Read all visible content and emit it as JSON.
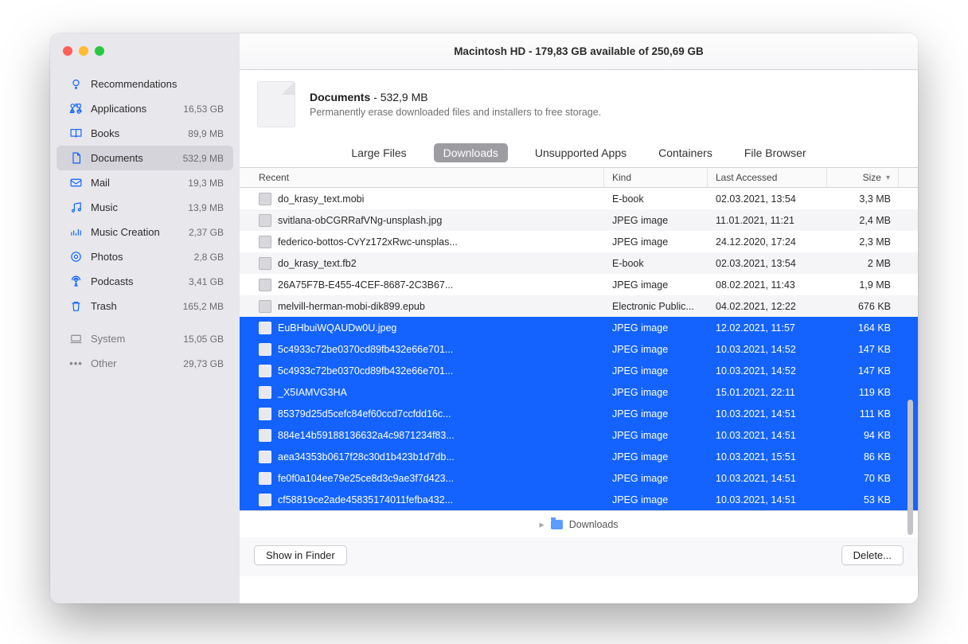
{
  "title": "Macintosh HD - 179,83 GB available of 250,69 GB",
  "info": {
    "name": "Documents",
    "size": "532,9 MB",
    "desc": "Permanently erase downloaded files and installers to free storage."
  },
  "sidebar": [
    {
      "icon": "bulb",
      "label": "Recommendations",
      "size": ""
    },
    {
      "icon": "apps",
      "label": "Applications",
      "size": "16,53 GB"
    },
    {
      "icon": "book",
      "label": "Books",
      "size": "89,9 MB"
    },
    {
      "icon": "doc",
      "label": "Documents",
      "size": "532,9 MB",
      "selected": true
    },
    {
      "icon": "mail",
      "label": "Mail",
      "size": "19,3 MB"
    },
    {
      "icon": "music",
      "label": "Music",
      "size": "13,9 MB"
    },
    {
      "icon": "garage",
      "label": "Music Creation",
      "size": "2,37 GB"
    },
    {
      "icon": "photos",
      "label": "Photos",
      "size": "2,8 GB"
    },
    {
      "icon": "podcast",
      "label": "Podcasts",
      "size": "3,41 GB"
    },
    {
      "icon": "trash",
      "label": "Trash",
      "size": "165,2 MB"
    }
  ],
  "sidebar2": [
    {
      "icon": "laptop",
      "label": "System",
      "size": "15,05 GB"
    },
    {
      "icon": "dots",
      "label": "Other",
      "size": "29,73 GB"
    }
  ],
  "tabs": {
    "large": "Large Files",
    "downloads": "Downloads",
    "unsupported": "Unsupported Apps",
    "containers": "Containers",
    "browser": "File Browser"
  },
  "columns": {
    "name": "Recent",
    "kind": "Kind",
    "last": "Last Accessed",
    "size": "Size"
  },
  "rows": [
    {
      "name": "do_krasy_text.mobi",
      "kind": "E-book",
      "last": "02.03.2021, 13:54",
      "size": "3,3 MB"
    },
    {
      "name": "svitlana-obCGRRafVNg-unsplash.jpg",
      "kind": "JPEG image",
      "last": "11.01.2021, 11:21",
      "size": "2,4 MB"
    },
    {
      "name": "federico-bottos-CvYz172xRwc-unsplas...",
      "kind": "JPEG image",
      "last": "24.12.2020, 17:24",
      "size": "2,3 MB"
    },
    {
      "name": "do_krasy_text.fb2",
      "kind": "E-book",
      "last": "02.03.2021, 13:54",
      "size": "2 MB"
    },
    {
      "name": "26A75F7B-E455-4CEF-8687-2C3B67...",
      "kind": "JPEG image",
      "last": "08.02.2021, 11:43",
      "size": "1,9 MB"
    },
    {
      "name": "melvill-herman-mobi-dik899.epub",
      "kind": "Electronic Public...",
      "last": "04.02.2021, 12:22",
      "size": "676 KB"
    },
    {
      "name": "EuBHbuiWQAUDw0U.jpeg",
      "kind": "JPEG image",
      "last": "12.02.2021, 11:57",
      "size": "164 KB",
      "sel": true
    },
    {
      "name": "5c4933c72be0370cd89fb432e66e701...",
      "kind": "JPEG image",
      "last": "10.03.2021, 14:52",
      "size": "147 KB",
      "sel": true
    },
    {
      "name": "5c4933c72be0370cd89fb432e66e701...",
      "kind": "JPEG image",
      "last": "10.03.2021, 14:52",
      "size": "147 KB",
      "sel": true
    },
    {
      "name": "_X5IAMVG3HA",
      "kind": "JPEG image",
      "last": "15.01.2021, 22:11",
      "size": "119 KB",
      "sel": true
    },
    {
      "name": "85379d25d5cefc84ef60ccd7ccfdd16c...",
      "kind": "JPEG image",
      "last": "10.03.2021, 14:51",
      "size": "111 KB",
      "sel": true
    },
    {
      "name": "884e14b59188136632a4c9871234f83...",
      "kind": "JPEG image",
      "last": "10.03.2021, 14:51",
      "size": "94 KB",
      "sel": true
    },
    {
      "name": "aea34353b0617f28c30d1b423b1d7db...",
      "kind": "JPEG image",
      "last": "10.03.2021, 15:51",
      "size": "86 KB",
      "sel": true
    },
    {
      "name": "fe0f0a104ee79e25ce8d3c9ae3f7d423...",
      "kind": "JPEG image",
      "last": "10.03.2021, 14:51",
      "size": "70 KB",
      "sel": true
    },
    {
      "name": "cf58819ce2ade45835174011fefba432...",
      "kind": "JPEG image",
      "last": "10.03.2021, 14:51",
      "size": "53 KB",
      "sel": true
    }
  ],
  "path": {
    "folder": "Downloads"
  },
  "buttons": {
    "finder": "Show in Finder",
    "delete": "Delete..."
  }
}
